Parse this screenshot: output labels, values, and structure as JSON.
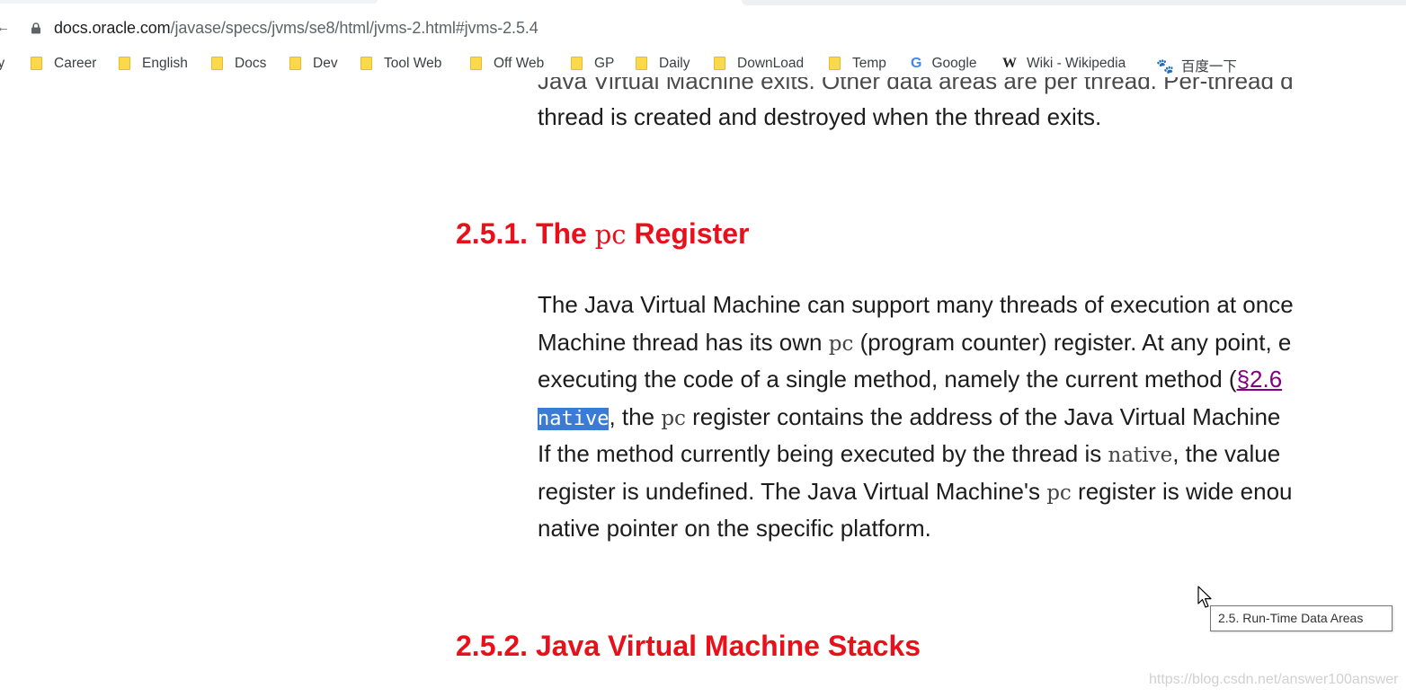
{
  "browser": {
    "url_domain": "docs.oracle.com",
    "url_path": "/javase/specs/jvms/se8/html/jvms-2.html#jvms-2.5.4",
    "bookmarks": [
      {
        "label": "ly",
        "icon": "folder-icon"
      },
      {
        "label": "Career",
        "icon": "folder-icon"
      },
      {
        "label": "English",
        "icon": "folder-icon"
      },
      {
        "label": "Docs",
        "icon": "folder-icon"
      },
      {
        "label": "Dev",
        "icon": "folder-icon"
      },
      {
        "label": "Tool Web",
        "icon": "folder-icon"
      },
      {
        "label": "Off Web",
        "icon": "folder-icon"
      },
      {
        "label": "GP",
        "icon": "folder-icon"
      },
      {
        "label": "Daily",
        "icon": "folder-icon"
      },
      {
        "label": "DownLoad",
        "icon": "folder-icon"
      },
      {
        "label": "Temp",
        "icon": "folder-icon"
      },
      {
        "label": "Google",
        "icon": "google-icon",
        "glyph": "G"
      },
      {
        "label": "Wiki - Wikipedia",
        "icon": "wikipedia-icon",
        "glyph": "W"
      },
      {
        "label": "百度一下",
        "icon": "baidu-paw-icon",
        "glyph": "🐾"
      }
    ]
  },
  "doc": {
    "intro_line_partial": "Java Virtual Machine exits. Other data areas are per thread. Per-thread d",
    "intro_line": "thread is created and destroyed when the thread exits.",
    "section_251": {
      "number": "2.5.1.",
      "pre": "The",
      "code": "pc",
      "post": "Register"
    },
    "para_251": {
      "l1": "The Java Virtual Machine can support many threads of execution at once",
      "l2_a": "Machine thread has its own ",
      "l2_code": "pc",
      "l2_b": " (program counter) register. At any point, e",
      "l3_a": "executing the code of a single method, namely the current method (",
      "l3_link": "§2.6",
      "l4_sel": "native",
      "l4_a": ", the ",
      "l4_code": "pc",
      "l4_b": " register contains the address of the Java Virtual Machine",
      "l5_a": "If the method currently being executed by the thread is ",
      "l5_code": "native",
      "l5_b": ", the value",
      "l6_a": "register is undefined. The Java Virtual Machine's ",
      "l6_code": "pc",
      "l6_b": " register is wide enou",
      "l7": "native pointer on the specific platform."
    },
    "section_252": {
      "number": "2.5.2.",
      "title": "Java Virtual Machine Stacks"
    }
  },
  "tooltip": "2.5. Run-Time Data Areas",
  "watermark": "https://blog.csdn.net/answer100answer",
  "colors": {
    "heading": "#e8101a",
    "selection": "#3a7bd5",
    "link": "#800080"
  }
}
